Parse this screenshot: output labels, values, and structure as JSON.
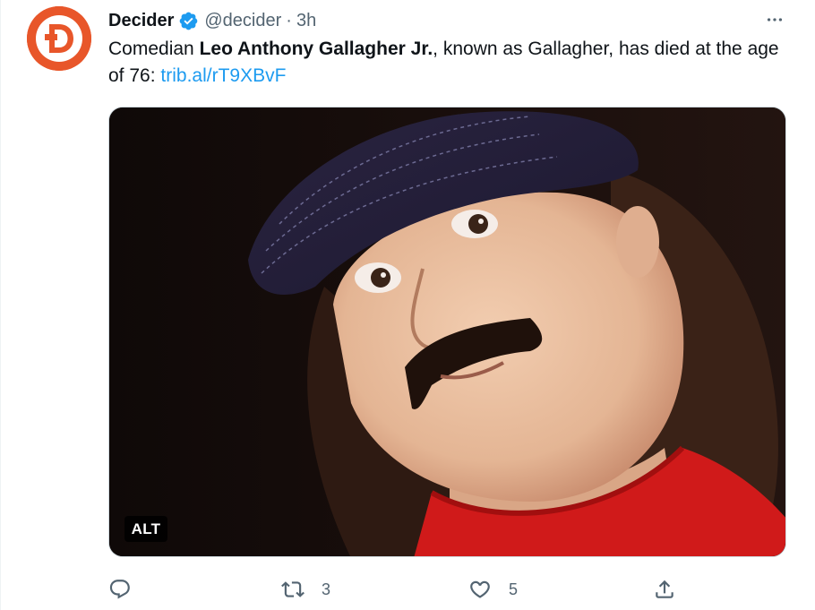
{
  "author": {
    "name": "Decider",
    "handle": "@decider",
    "separator": "·",
    "time": "3h",
    "avatar_color": "#e8562a",
    "avatar_letter": "D"
  },
  "tweet": {
    "text_before": "Comedian ",
    "text_bold": "Leo Anthony Gallagher Jr.",
    "text_after": ", known as Gallagher, has died at the age of 76: ",
    "link": "trib.al/rT9XBvF"
  },
  "media": {
    "alt_label": "ALT"
  },
  "actions": {
    "reply_icon": "reply-icon",
    "retweet_icon": "retweet-icon",
    "retweet_count": "3",
    "like_icon": "heart-icon",
    "like_count": "5",
    "share_icon": "share-icon"
  },
  "colors": {
    "link": "#1d9bf0",
    "secondary_text": "#536471",
    "verified": "#1d9bf0"
  }
}
